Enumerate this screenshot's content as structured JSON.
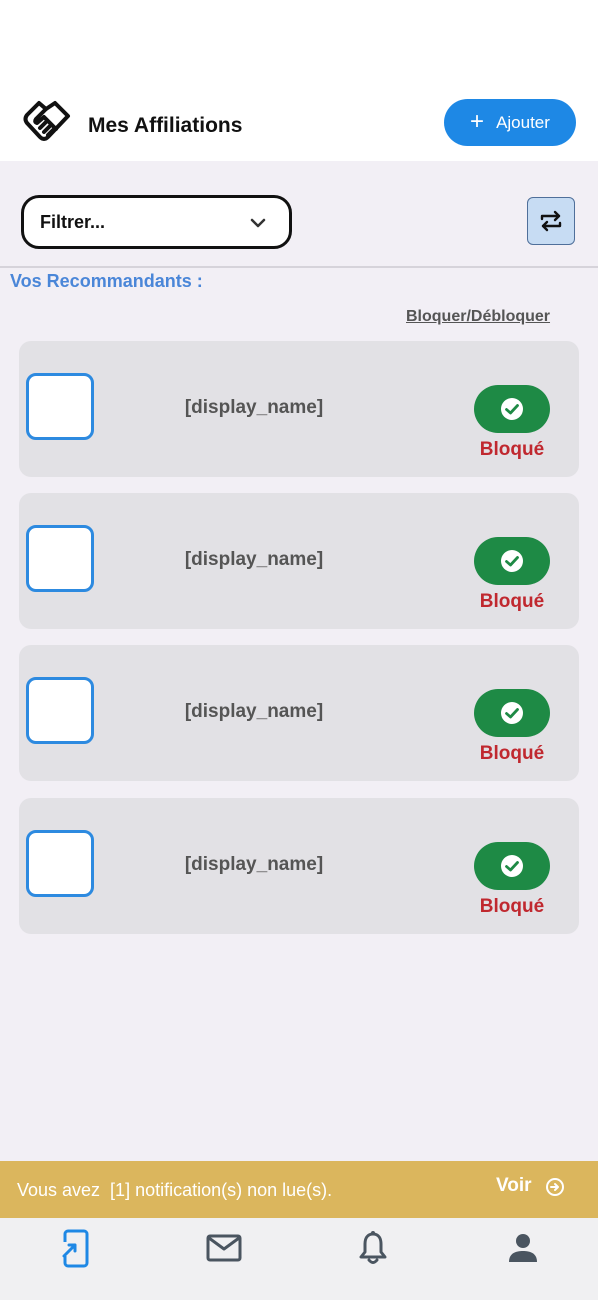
{
  "header": {
    "title": "Mes Affiliations",
    "add_button_label": "Ajouter",
    "logo_icon": "handshake-icon",
    "add_icon": "plus-icon"
  },
  "filter": {
    "placeholder": "Filtrer...",
    "icon": "chevron-down-icon"
  },
  "swap_button": {
    "icon": "swap-arrows-icon"
  },
  "section": {
    "title": "Vos Recommandants :",
    "block_toggle_label": "Bloquer/Débloquer"
  },
  "referrers": [
    {
      "name": "[display_name]",
      "status": "Bloqué"
    },
    {
      "name": "[display_name]",
      "status": "Bloqué"
    },
    {
      "name": "[display_name]",
      "status": "Bloqué"
    },
    {
      "name": "[display_name]",
      "status": "Bloqué"
    }
  ],
  "notification": {
    "text": "Vous avez  [1] notification(s) non lue(s).",
    "action_label": "Voir",
    "action_icon": "arrow-right-circle-icon"
  },
  "bottom_nav": [
    {
      "name": "affiliations",
      "icon": "phone-share-icon",
      "active": true
    },
    {
      "name": "messages",
      "icon": "mail-icon",
      "active": false
    },
    {
      "name": "notifications",
      "icon": "bell-icon",
      "active": false
    },
    {
      "name": "profile",
      "icon": "person-icon",
      "active": false
    }
  ],
  "colors": {
    "primary": "#1e88e5",
    "section_title": "#4a86d8",
    "toggle_on": "#1e8a45",
    "status_blocked": "#c0282f",
    "notification_bg": "#dbb65d",
    "nav_active": "#1e88e5",
    "nav_inactive": "#4a5560"
  }
}
